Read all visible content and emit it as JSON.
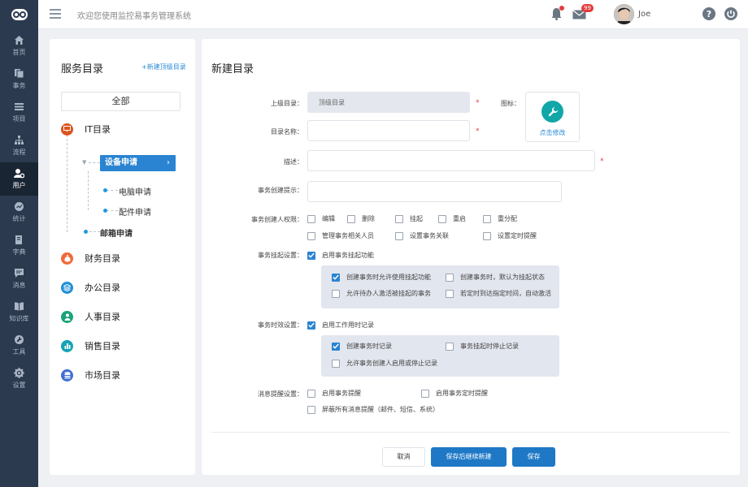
{
  "sidebar": {
    "items": [
      {
        "label": "首页",
        "icon": "home-icon"
      },
      {
        "label": "事务",
        "icon": "documents-icon"
      },
      {
        "label": "项目",
        "icon": "list-icon"
      },
      {
        "label": "流程",
        "icon": "flow-icon"
      },
      {
        "label": "用户",
        "icon": "user-gear-icon",
        "active": true
      },
      {
        "label": "统计",
        "icon": "chart-icon"
      },
      {
        "label": "字典",
        "icon": "book-icon"
      },
      {
        "label": "消息",
        "icon": "message-icon"
      },
      {
        "label": "知识库",
        "icon": "knowledge-icon"
      },
      {
        "label": "工具",
        "icon": "wrench-icon"
      },
      {
        "label": "设置",
        "icon": "gear-icon"
      }
    ]
  },
  "topbar": {
    "welcome": "欢迎您使用监控易事务管理系统",
    "mail_badge": "99",
    "username": "Joe"
  },
  "catalog": {
    "title": "服务目录",
    "new_top": "+新建顶级目录",
    "all": "全部",
    "categories": [
      {
        "label": "IT目录",
        "color": "#d9541e"
      },
      {
        "label": "财务目录",
        "color": "#f06a3a"
      },
      {
        "label": "办公目录",
        "color": "#1f8fd8"
      },
      {
        "label": "人事目录",
        "color": "#1aa37a"
      },
      {
        "label": "销售目录",
        "color": "#16a3b5"
      },
      {
        "label": "市场目录",
        "color": "#3f6fd1"
      }
    ],
    "sub_active": "设备申请",
    "leaves": [
      "电脑申请",
      "配件申请"
    ],
    "sub2": "邮箱申请"
  },
  "form": {
    "title": "新建目录",
    "parent_label": "上级目录：",
    "parent_value": "顶级目录",
    "icon_label": "图标：",
    "icon_change": "点击修改",
    "name_label": "目录名称：",
    "desc_label": "描述：",
    "hint_label": "事务创建提示：",
    "perm_label": "事务创建人权限：",
    "perms": [
      "编辑",
      "删除",
      "挂起",
      "重启",
      "重分配",
      "管理事务相关人员",
      "设置事务关联",
      "设置定时提醒"
    ],
    "suspend_label": "事务挂起设置：",
    "suspend_enable": "启用事务挂起功能",
    "suspend_opts": [
      "创建事务时允许使用挂起功能",
      "创建事务时，默认为挂起状态",
      "允许待办人激活被挂起的事务",
      "若定时到达指定时间，自动激活"
    ],
    "time_label": "事务时效设置：",
    "time_enable": "启用工作用时记录",
    "time_opts": [
      "创建事务时记录",
      "事务挂起时停止记录",
      "允许事务创建人启用或停止记录"
    ],
    "msg_label": "消息提醒设置：",
    "msg_opts": [
      "启用事务提醒",
      "启用事务定时提醒",
      "屏蔽所有消息提醒（邮件、短信、系统）"
    ],
    "cancel": "取消",
    "save_continue": "保存后继续新建",
    "save": "保存"
  }
}
